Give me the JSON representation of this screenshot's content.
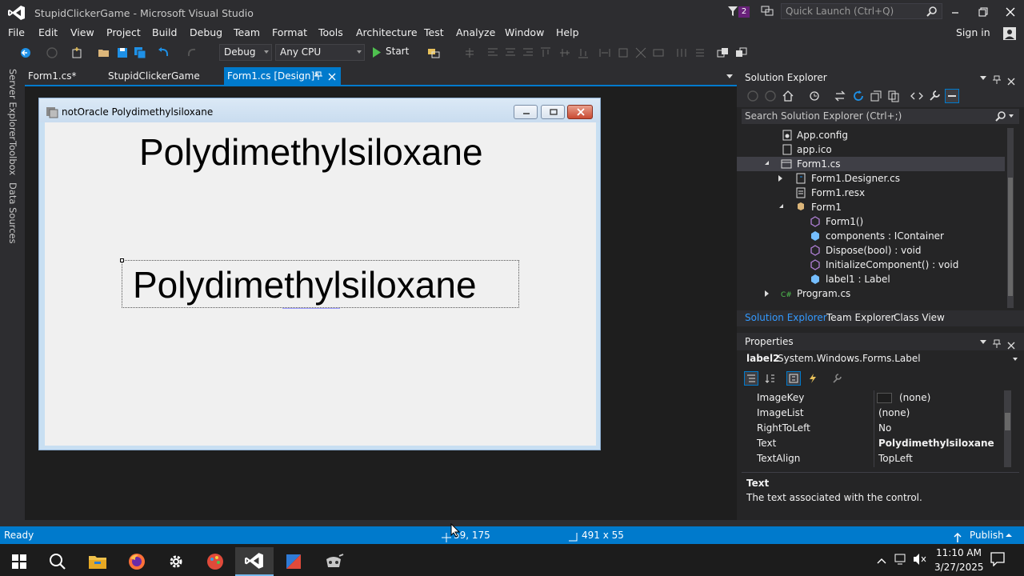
{
  "window": {
    "title": "StupidClickerGame - Microsoft Visual Studio",
    "notification_count": "2",
    "quick_launch_placeholder": "Quick Launch (Ctrl+Q)"
  },
  "menu": {
    "items": [
      "File",
      "Edit",
      "View",
      "Project",
      "Build",
      "Debug",
      "Team",
      "Format",
      "Tools",
      "Architecture",
      "Test",
      "Analyze",
      "Window",
      "Help"
    ],
    "sign_in": "Sign in"
  },
  "toolbar": {
    "configuration": "Debug",
    "platform": "Any CPU",
    "start_label": "Start"
  },
  "left_strip": {
    "tabs": [
      "Server Explorer",
      "Toolbox",
      "Data Sources"
    ]
  },
  "document_tabs": [
    {
      "label": "Form1.cs*"
    },
    {
      "label": "StupidClickerGame"
    },
    {
      "label": "Form1.cs [Design]*"
    }
  ],
  "form_designer": {
    "form_title": "notOracle Polydimethylsiloxane",
    "label1_text": "Polydimethylsiloxane",
    "label2_text": "Polydimethylsiloxane"
  },
  "solution_explorer": {
    "title": "Solution Explorer",
    "search_placeholder": "Search Solution Explorer (Ctrl+;)",
    "tree": [
      {
        "label": "App.config"
      },
      {
        "label": "app.ico"
      },
      {
        "label": "Form1.cs"
      },
      {
        "label": "Form1.Designer.cs"
      },
      {
        "label": "Form1.resx"
      },
      {
        "label": "Form1"
      },
      {
        "label": "Form1()"
      },
      {
        "label": "components : IContainer"
      },
      {
        "label": "Dispose(bool) : void"
      },
      {
        "label": "InitializeComponent() : void"
      },
      {
        "label": "label1 : Label"
      },
      {
        "label": "Program.cs"
      }
    ],
    "bottom_tabs": [
      "Solution Explorer",
      "Team Explorer",
      "Class View"
    ]
  },
  "properties": {
    "title": "Properties",
    "object": "label2",
    "object_type": "System.Windows.Forms.Label",
    "rows": [
      {
        "name": "ImageKey",
        "value": "(none)"
      },
      {
        "name": "ImageList",
        "value": "(none)"
      },
      {
        "name": "RightToLeft",
        "value": "No"
      },
      {
        "name": "Text",
        "value": "Polydimethylsiloxane"
      },
      {
        "name": "TextAlign",
        "value": "TopLeft"
      }
    ],
    "description_title": "Text",
    "description": "The text associated with the control."
  },
  "statusbar": {
    "status": "Ready",
    "position": "59, 175",
    "size": "491 x 55",
    "publish": "Publish"
  },
  "taskbar": {
    "time": "11:10 AM",
    "date": "3/27/2025"
  },
  "colors": {
    "accent": "#007acc",
    "vs_purple": "#68217a"
  }
}
